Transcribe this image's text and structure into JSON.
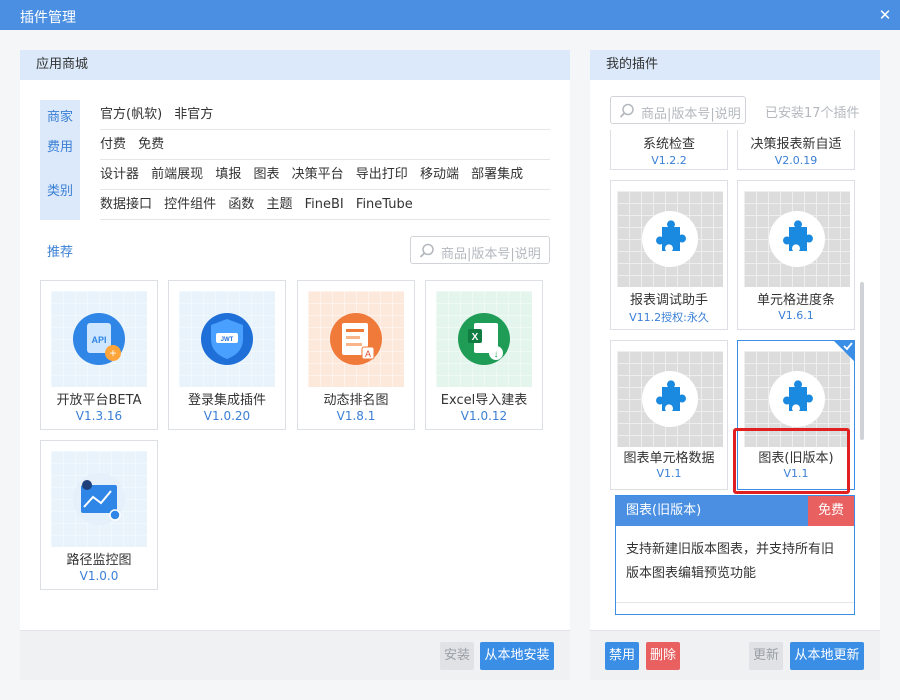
{
  "window": {
    "title": "插件管理",
    "close_glyph": "✕"
  },
  "store": {
    "header": "应用商城",
    "filter_tabs": [
      "商家",
      "费用",
      "类别"
    ],
    "merchant_options": [
      "官方(帆软)",
      "非官方"
    ],
    "fee_options": [
      "付费",
      "免费"
    ],
    "category_row1": [
      "设计器",
      "前端展现",
      "填报",
      "图表",
      "决策平台",
      "导出打印",
      "移动端",
      "部署集成"
    ],
    "category_row2": [
      "数据接口",
      "控件组件",
      "函数",
      "主题",
      "FineBI",
      "FineTube"
    ],
    "recommend_label": "推荐",
    "search_placeholder": "商品|版本号|说明",
    "cards": [
      {
        "name": "开放平台BETA",
        "version": "V1.3.16",
        "icon": "api-icon"
      },
      {
        "name": "登录集成插件",
        "version": "V1.0.20",
        "icon": "shield-icon"
      },
      {
        "name": "动态排名图",
        "version": "V1.8.1",
        "icon": "chart-doc-icon"
      },
      {
        "name": "Excel导入建表",
        "version": "V1.0.12",
        "icon": "excel-icon"
      },
      {
        "name": "路径监控图",
        "version": "V1.0.0",
        "icon": "map-route-icon"
      }
    ],
    "install_button": "安装",
    "local_install_button": "从本地安装"
  },
  "mine": {
    "header": "我的插件",
    "search_placeholder": "商品|版本号|说明",
    "installed_count": "已安装17个插件",
    "partial_cards": [
      {
        "name": "系统检查",
        "version": "V1.2.2"
      },
      {
        "name": "决策报表新自适",
        "version": "V2.0.19"
      }
    ],
    "cards": [
      {
        "name": "报表调试助手",
        "version": "V11.2授权:永久"
      },
      {
        "name": "单元格进度条",
        "version": "V1.6.1"
      },
      {
        "name": "图表单元格数据",
        "version": "V1.1"
      },
      {
        "name": "图表(旧版本)",
        "version": "V1.1"
      }
    ],
    "detail": {
      "title": "图表(旧版本)",
      "fee": "免费",
      "description": "支持新建旧版本图表，并支持所有旧版本图表编辑预览功能"
    },
    "disable_button": "禁用",
    "delete_button": "删除",
    "update_button": "更新",
    "local_update_button": "从本地更新"
  },
  "colors": {
    "accent": "#4a8fe2",
    "link": "#3a7fd5",
    "danger": "#e86060",
    "highlight_box": "#e02020"
  }
}
